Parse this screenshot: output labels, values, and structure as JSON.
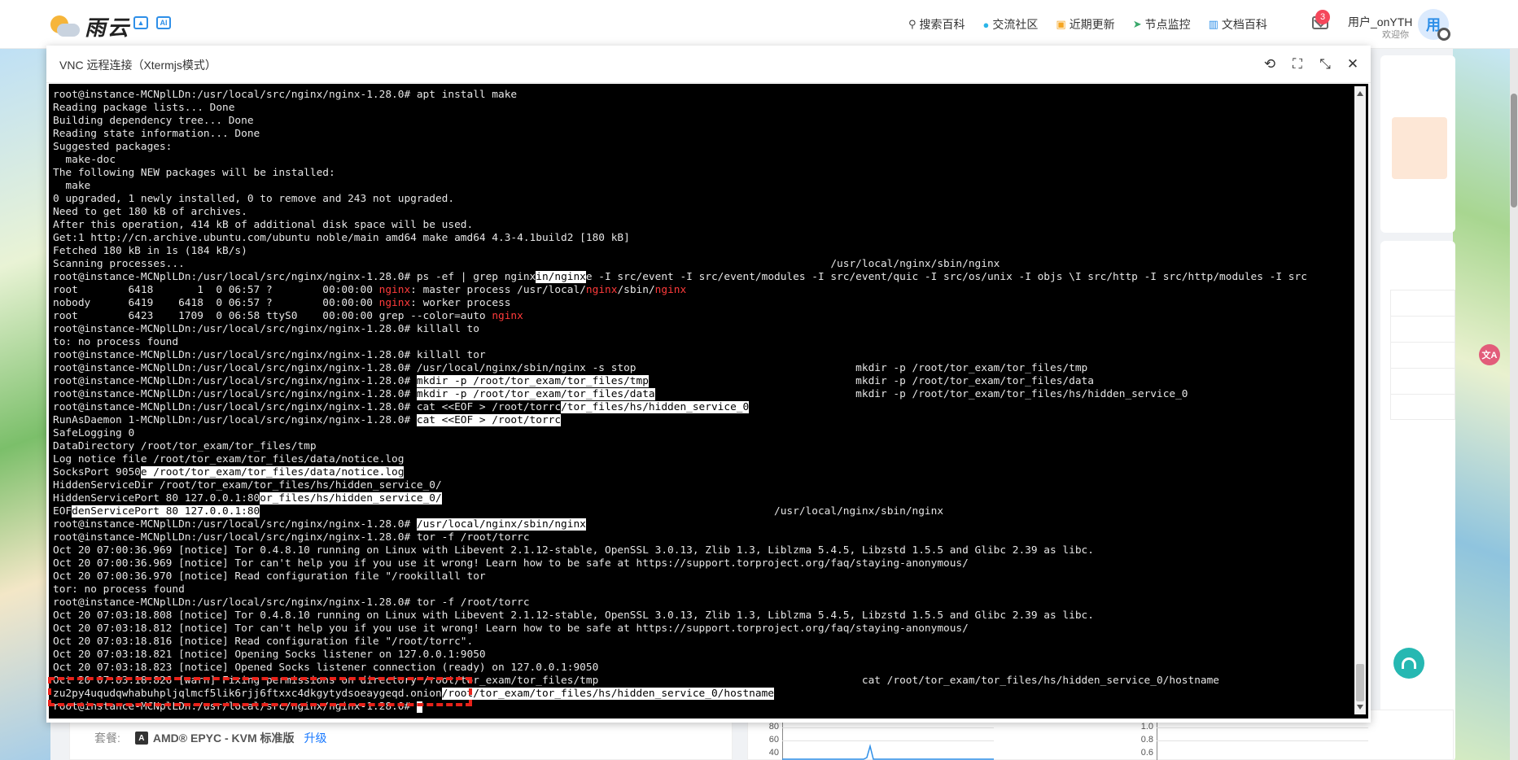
{
  "header": {
    "logo_text": "雨云",
    "nav": [
      {
        "icon": "search-icon",
        "label": "搜索百科"
      },
      {
        "icon": "community-icon",
        "label": "交流社区"
      },
      {
        "icon": "updates-icon",
        "label": "近期更新"
      },
      {
        "icon": "monitor-icon",
        "label": "节点监控"
      },
      {
        "icon": "docs-icon",
        "label": "文档百科"
      }
    ],
    "mail_badge": "3",
    "user_name": "用户_onYTH",
    "user_sub": "欢迎你",
    "avatar_char": "用"
  },
  "modal": {
    "title": "VNC 远程连接（Xtermjs模式）"
  },
  "terminal": {
    "lines": [
      {
        "t": "root@instance-MCNplLDn:/usr/local/src/nginx/nginx-1.28.0# apt install make"
      },
      {
        "t": "Reading package lists... Done"
      },
      {
        "t": "Building dependency tree... Done"
      },
      {
        "t": "Reading state information... Done"
      },
      {
        "t": "Suggested packages:"
      },
      {
        "t": "  make-doc"
      },
      {
        "t": "The following NEW packages will be installed:"
      },
      {
        "t": "  make"
      },
      {
        "t": "0 upgraded, 1 newly installed, 0 to remove and 243 not upgraded."
      },
      {
        "t": "Need to get 180 kB of archives."
      },
      {
        "t": "After this operation, 414 kB of additional disk space will be used."
      },
      {
        "t": "Get:1 http://cn.archive.ubuntu.com/ubuntu noble/main amd64 make amd64 4.3-4.1build2 [180 kB]"
      },
      {
        "t": "Fetched 180 kB in 1s (184 kB/s)"
      },
      {
        "t": "Scanning processes...                                                                                                       /usr/local/nginx/sbin/nginx"
      },
      {
        "t": "root@instance-MCNplLDn:/usr/local/src/nginx/nginx-1.28.0# ps -ef | grep nginx",
        "hl": "in/nginx",
        "t2": "e -I src/event -I src/event/modules -I src/event/quic -I src/os/unix -I objs \\I src/http -I src/http/modules -I src"
      },
      {
        "t": "root        6418       1  0 06:57 ?        00:00:00 ",
        "r1": "nginx",
        "t2": ": master process /usr/local/",
        "r2": "nginx",
        "t3": "/sbin/",
        "r3": "nginx"
      },
      {
        "t": "nobody      6419    6418  0 06:57 ?        00:00:00 ",
        "r1": "nginx",
        "t2": ": worker process"
      },
      {
        "t": "root        6423    1709  0 06:58 ttyS0    00:00:00 grep --color=auto ",
        "r1": "nginx"
      },
      {
        "t": "root@instance-MCNplLDn:/usr/local/src/nginx/nginx-1.28.0# killall to"
      },
      {
        "t": "to: no process found"
      },
      {
        "t": "root@instance-MCNplLDn:/usr/local/src/nginx/nginx-1.28.0# killall tor"
      },
      {
        "t": "root@instance-MCNplLDn:/usr/local/src/nginx/nginx-1.28.0# /usr/local/nginx/sbin/nginx -s stop                                   mkdir -p /root/tor_exam/tor_files/tmp"
      },
      {
        "t": "root@instance-MCNplLDn:/usr/local/src/nginx/nginx-1.28.0# ",
        "hl": "mkdir -p /root/tor_exam/tor_files/tmp",
        "t2": "                                 mkdir -p /root/tor_exam/tor_files/data"
      },
      {
        "t": "root@instance-MCNplLDn:/usr/local/src/nginx/nginx-1.28.0# ",
        "hl": "mkdir -p /root/tor_exam/tor_files/data",
        "t2": "                                mkdir -p /root/tor_exam/tor_files/hs/hidden_service_0"
      },
      {
        "t": "root@instance-MCNplLDn:/usr/local/src/nginx/nginx-1.28.0# cat <<EOF > /root/torrc",
        "hl": "/tor_files/hs/hidden_service_0"
      },
      {
        "t": "RunAsDaemon 1-MCNplLDn:/usr/local/src/nginx/nginx-1.28.0# ",
        "hl": "cat <<EOF > /root/torrc"
      },
      {
        "t": "SafeLogging 0"
      },
      {
        "t": "DataDirectory /root/tor_exam/tor_files/tmp"
      },
      {
        "t": "Log notice file /root/tor_exam/tor_files/data/notice.log"
      },
      {
        "t": "SocksPort 9050",
        "hl": "e /root/tor_exam/tor_files/data/notice.log"
      },
      {
        "t": "HiddenServiceDir /root/tor_exam/tor_files/hs/hidden_service_0/"
      },
      {
        "t": "HiddenServicePort 80 127.0.0.1:80",
        "hl": "or_files/hs/hidden_service_0/"
      },
      {
        "t": "EOF",
        "hl": "denServicePort 80 127.0.0.1:80",
        "t2": "                                                                                  /usr/local/nginx/sbin/nginx"
      },
      {
        "t": "root@instance-MCNplLDn:/usr/local/src/nginx/nginx-1.28.0# ",
        "hl": "/usr/local/nginx/sbin/nginx"
      },
      {
        "t": "root@instance-MCNplLDn:/usr/local/src/nginx/nginx-1.28.0# tor -f /root/torrc"
      },
      {
        "t": "Oct 20 07:00:36.969 [notice] Tor 0.4.8.10 running on Linux with Libevent 2.1.12-stable, OpenSSL 3.0.13, Zlib 1.3, Liblzma 5.4.5, Libzstd 1.5.5 and Glibc 2.39 as libc."
      },
      {
        "t": "Oct 20 07:00:36.969 [notice] Tor can't help you if you use it wrong! Learn how to be safe at https://support.torproject.org/faq/staying-anonymous/"
      },
      {
        "t": "Oct 20 07:00:36.970 [notice] Read configuration file \"/rookillall tor"
      },
      {
        "t": "tor: no process found"
      },
      {
        "t": "root@instance-MCNplLDn:/usr/local/src/nginx/nginx-1.28.0# tor -f /root/torrc"
      },
      {
        "t": "Oct 20 07:03:18.808 [notice] Tor 0.4.8.10 running on Linux with Libevent 2.1.12-stable, OpenSSL 3.0.13, Zlib 1.3, Liblzma 5.4.5, Libzstd 1.5.5 and Glibc 2.39 as libc."
      },
      {
        "t": "Oct 20 07:03:18.812 [notice] Tor can't help you if you use it wrong! Learn how to be safe at https://support.torproject.org/faq/staying-anonymous/"
      },
      {
        "t": "Oct 20 07:03:18.816 [notice] Read configuration file \"/root/torrc\"."
      },
      {
        "t": "Oct 20 07:03:18.821 [notice] Opening Socks listener on 127.0.0.1:9050"
      },
      {
        "t": "Oct 20 07:03:18.823 [notice] Opened Socks listener connection (ready) on 127.0.0.1:9050"
      },
      {
        "t": "Oct 20 07:03:18.826 [warn] Fixing permissions on directory /root/tor_exam/tor_files/tmp                                          cat /root/tor_exam/tor_files/hs/hidden_service_0/hostname"
      },
      {
        "t": "zu2py4uqudqwhabuhpljqlmcf5lik6rjj6ftxxc4dkgytydsoeaygeqd.onion",
        "hl": "/root/tor_exam/tor_files/hs/hidden_service_0/hostname"
      },
      {
        "t": "root@instance-MCNplLDn:/usr/local/src/nginx/nginx-1.28.0# ",
        "cursor": true
      }
    ]
  },
  "bottom_panel": {
    "package_label": "套餐:",
    "package_icon": "A",
    "package_name": "AMD® EPYC - KVM 标准版",
    "upgrade_label": "升级"
  },
  "mini_charts": [
    {
      "ticks": [
        "80",
        "60",
        "40"
      ]
    },
    {
      "ticks": [
        "1.0",
        "0.8",
        "0.6"
      ]
    }
  ]
}
